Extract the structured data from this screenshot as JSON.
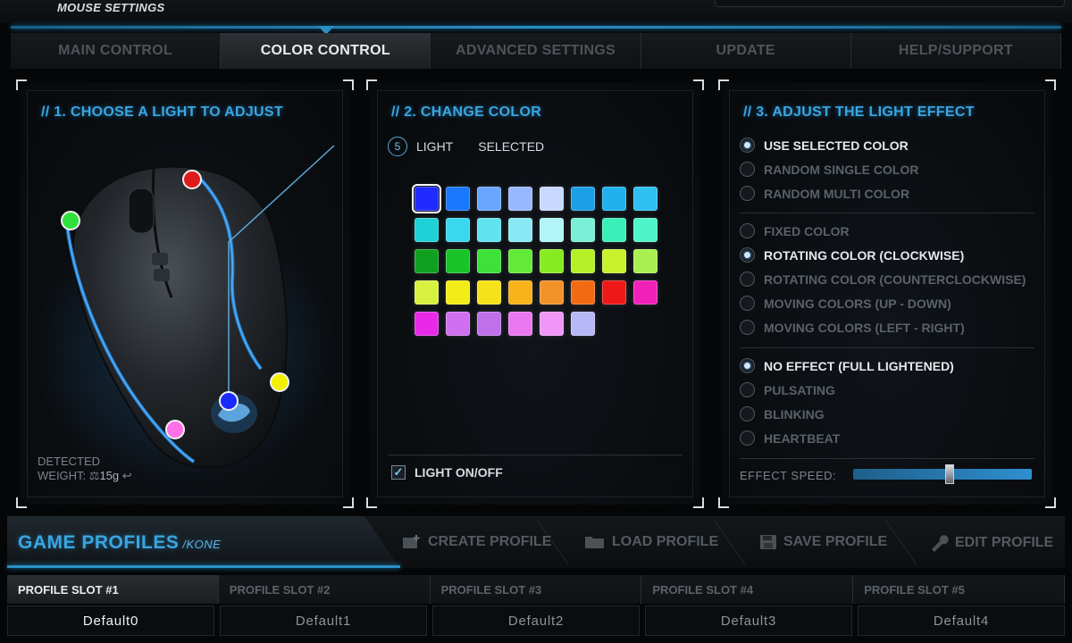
{
  "app": {
    "title": "MOUSE SETTINGS"
  },
  "tabs": [
    {
      "label": "MAIN CONTROL",
      "active": false
    },
    {
      "label": "COLOR CONTROL",
      "active": true
    },
    {
      "label": "ADVANCED SETTINGS",
      "active": false
    },
    {
      "label": "UPDATE",
      "active": false
    },
    {
      "label": "HELP/SUPPORT",
      "active": false
    }
  ],
  "panel1": {
    "title": "// 1. CHOOSE A LIGHT TO ADJUST",
    "detected_label": "DETECTED",
    "weight_label": "WEIGHT:",
    "weight_value": "15g",
    "lights": [
      {
        "color": "#e01b1b"
      },
      {
        "color": "#2ee03a"
      },
      {
        "color": "#1a2bff"
      },
      {
        "color": "#f0f000"
      },
      {
        "color": "#ff70e8"
      }
    ]
  },
  "panel2": {
    "title": "// 2. CHANGE COLOR",
    "light_number": "5",
    "light_label": "LIGHT",
    "selected_label": "SELECTED",
    "selected_index": 0,
    "swatches": [
      "#1f2bff",
      "#1a78ff",
      "#6aa6ff",
      "#98b8ff",
      "#c8d8ff",
      "#1b9fe6",
      "#21b1ee",
      "#2ec1f2",
      "#1fd0d6",
      "#3ad8ee",
      "#62e3f0",
      "#8ae8f5",
      "#b2f4f8",
      "#7af0d6",
      "#39f0b8",
      "#4ff5c8",
      "#0fa01f",
      "#18c42a",
      "#3ee03a",
      "#63ea39",
      "#88ea20",
      "#b4f028",
      "#c9f02c",
      "#a8f050",
      "#d8f040",
      "#f4ec18",
      "#f6e21a",
      "#f8b21a",
      "#f4922a",
      "#f26a12",
      "#ee1818",
      "#f020b8",
      "#e82ae8",
      "#d070f0",
      "#c070e8",
      "#ea78f0",
      "#f096f6",
      "#b8b8f6"
    ],
    "light_onoff_label": "LIGHT ON/OFF",
    "light_on": true
  },
  "panel3": {
    "title": "// 3. ADJUST THE LIGHT EFFECT",
    "color_modes": [
      {
        "label": "USE SELECTED COLOR",
        "on": true
      },
      {
        "label": "RANDOM SINGLE COLOR",
        "on": false
      },
      {
        "label": "RANDOM MULTI COLOR",
        "on": false
      }
    ],
    "movement_modes": [
      {
        "label": "FIXED COLOR",
        "on": false
      },
      {
        "label": "ROTATING COLOR (CLOCKWISE)",
        "on": true
      },
      {
        "label": "ROTATING COLOR (COUNTERCLOCKWISE)",
        "on": false
      },
      {
        "label": "MOVING COLORS (UP - DOWN)",
        "on": false
      },
      {
        "label": "MOVING COLORS (LEFT - RIGHT)",
        "on": false
      }
    ],
    "effects": [
      {
        "label": "NO EFFECT (FULL LIGHTENED)",
        "on": true
      },
      {
        "label": "PULSATING",
        "on": false
      },
      {
        "label": "BLINKING",
        "on": false
      },
      {
        "label": "HEARTBEAT",
        "on": false
      }
    ],
    "speed_label": "EFFECT SPEED:",
    "speed_fraction": 0.54
  },
  "profiles": {
    "title": "GAME PROFILES",
    "subtitle": "/KONE",
    "actions": [
      {
        "label": "CREATE PROFILE",
        "icon": "create-profile-icon"
      },
      {
        "label": "LOAD PROFILE",
        "icon": "folder-icon"
      },
      {
        "label": "SAVE PROFILE",
        "icon": "save-disk-icon"
      },
      {
        "label": "EDIT PROFILE",
        "icon": "wrench-icon"
      }
    ],
    "slots": [
      "PROFILE SLOT #1",
      "PROFILE SLOT #2",
      "PROFILE SLOT #3",
      "PROFILE SLOT #4",
      "PROFILE SLOT #5"
    ],
    "names": [
      "Default0",
      "Default1",
      "Default2",
      "Default3",
      "Default4"
    ],
    "active_slot": 0
  },
  "colors": {
    "accent": "#2b8fc4",
    "title_blue": "#3aa6e0"
  }
}
